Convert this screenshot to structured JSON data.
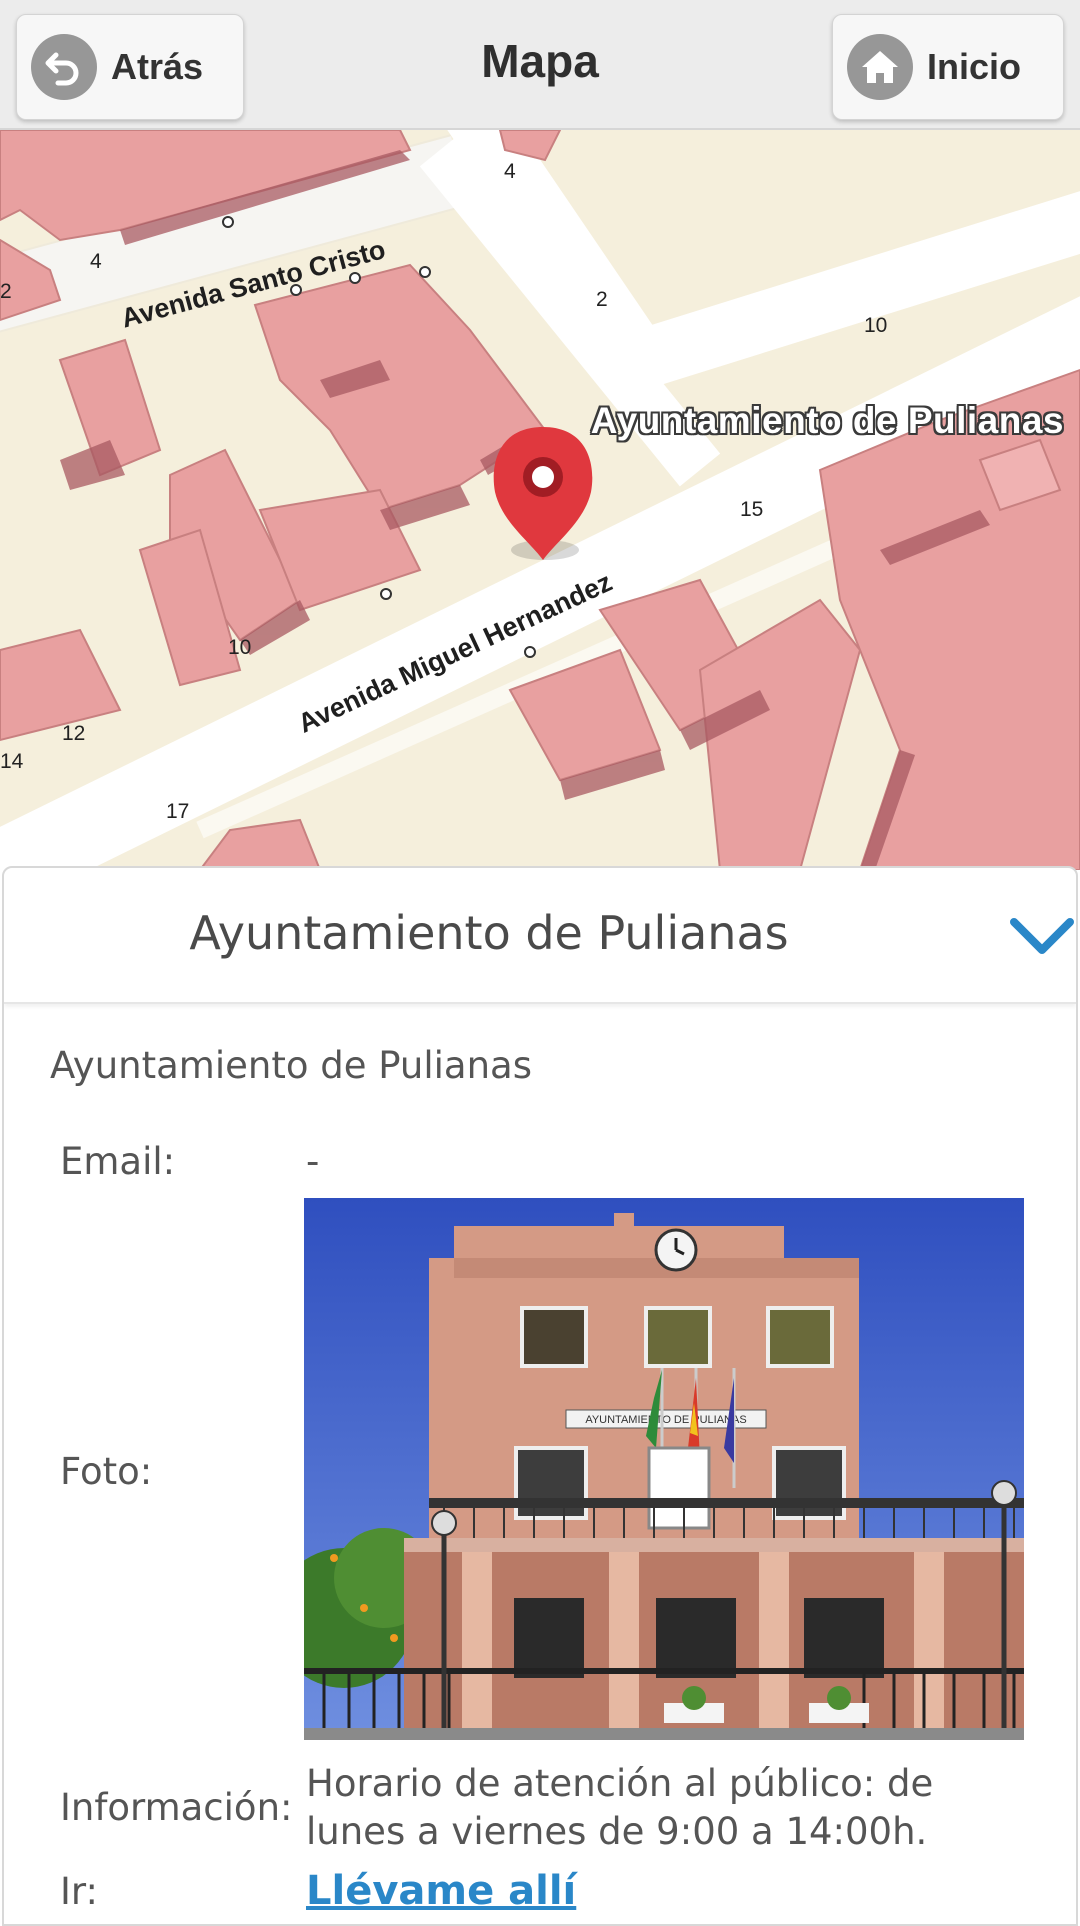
{
  "header": {
    "title": "Mapa",
    "back_label": "Atrás",
    "home_label": "Inicio"
  },
  "map": {
    "place_label": "Ayuntamiento de Pulianas",
    "streets": [
      "Avenida Santo Cristo",
      "Avenida Miguel Hernandez"
    ],
    "house_numbers": [
      "4",
      "4",
      "2",
      "10",
      "15",
      "10",
      "12",
      "14",
      "17",
      "2"
    ]
  },
  "panel": {
    "title": "Ayuntamiento de Pulianas",
    "subtitle": "Ayuntamiento de Pulianas",
    "email_label": "Email:",
    "email_value": "-",
    "photo_label": "Foto:",
    "photo_sign": "AYUNTAMIENTO DE PULIANAS",
    "info_label": "Información:",
    "info_value": "Horario de atención al público: de lunes a viernes de 9:00 a 14:00h.",
    "go_label": "Ir:",
    "go_link": "Llévame allí"
  },
  "colors": {
    "accent": "#2a87c8",
    "marker": "#e0383e",
    "building": "#e8a0a0",
    "block": "#f5efdc"
  }
}
